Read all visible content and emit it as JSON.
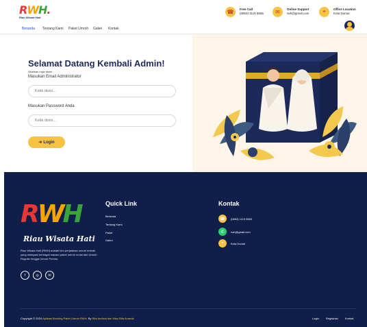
{
  "brand": {
    "logo_text_1": "R",
    "logo_text_2": "W",
    "logo_text_3": "H",
    "logo_dot": ".",
    "tagline": "Riau Wisata Hati"
  },
  "header": {
    "contacts": [
      {
        "title": "Free Call",
        "value": "(0853) 1115 5555"
      },
      {
        "title": "Online Support",
        "value": "rwh@gmail.com"
      },
      {
        "title": "Office Location",
        "value": "Kota Dumai"
      }
    ]
  },
  "nav": {
    "items": [
      "Beranda",
      "Tentang Kami",
      "Paket Umroh",
      "Galeri",
      "Kontak"
    ]
  },
  "login": {
    "title": "Selamat Datang Kembali Admin!",
    "subtitle": "Silahkan login disini",
    "email_label": "Masukan Email Administrator",
    "email_placeholder": "Ketik disini...",
    "password_label": "Masukan Password Anda",
    "password_placeholder": "Ketik disini...",
    "button_label": "Login"
  },
  "footer": {
    "description": "Riau Wisata Hati (RWH) adalah biro perjalanan umroh terbaik yang melayani berbagai macam paket umroh mulai dari Umroh Reguler hingga Umroh Premiu.",
    "quick_link_title": "Quick Link",
    "quick_links": [
      "Beranda",
      "Tentang Kami",
      "Paket",
      "Galeri"
    ],
    "contact_title": "Kontak",
    "contacts": [
      "(0853) 1115 5555",
      "rwh@gmail.com",
      "Kota Dumai"
    ],
    "copyright_prefix": "Copyright © 2024 ",
    "copyright_hl": "Aplikasi Booking Paket Umroh RWH",
    "copyright_mid": ". By ",
    "copyright_authors": "Rifa Andiani dan Nisa Rifa Ananda",
    "bottom_links": [
      "Login",
      "Registrasi",
      "Kontak"
    ]
  },
  "colors": {
    "navy": "#101f4a",
    "accent": "#f6c342",
    "cream": "#fdf6e8",
    "nav_active": "#1b4bd8"
  },
  "icons": [
    "phone-icon",
    "mail-icon",
    "location-icon",
    "user-avatar-icon",
    "login-icon",
    "facebook-icon",
    "instagram-icon",
    "email-icon",
    "whatsapp-icon"
  ]
}
